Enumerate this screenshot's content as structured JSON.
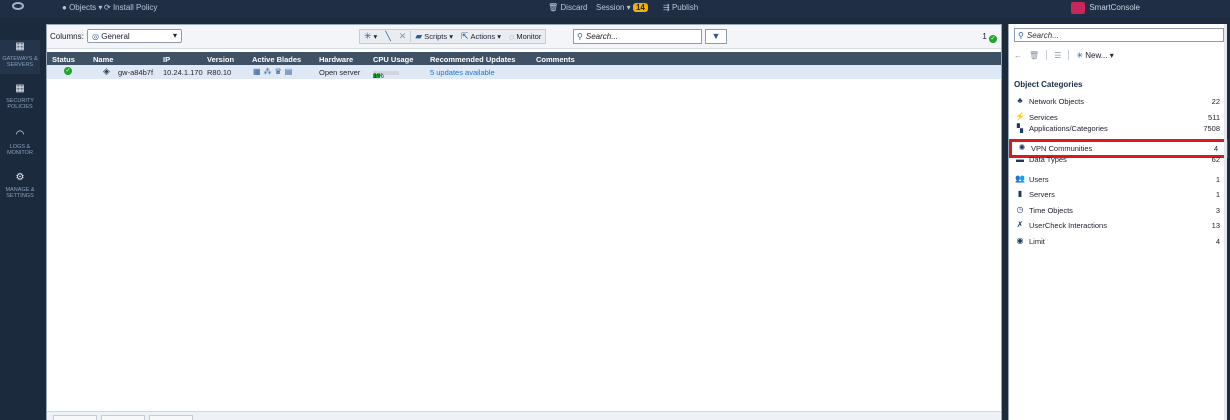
{
  "topbar": {
    "objects_menu": "Objects ▾",
    "install_policy": "Install Policy",
    "discard": "Discard",
    "session": "Session ▾",
    "session_count": "14",
    "publish": "Publish",
    "brand_name": "SmartConsole"
  },
  "leftnav": [
    {
      "label": "GATEWAYS & SERVERS",
      "icon": "gateways-icon"
    },
    {
      "label": "SECURITY POLICIES",
      "icon": "policies-icon"
    },
    {
      "label": "LOGS & MONITOR",
      "icon": "logs-icon"
    },
    {
      "label": "MANAGE & SETTINGS",
      "icon": "settings-icon"
    }
  ],
  "toolbar": {
    "columns_label": "Columns:",
    "columns_value": "General",
    "scripts": "Scripts ▾",
    "actions": "Actions ▾",
    "monitor": "Monitor",
    "search_placeholder": "Search...",
    "count": "1"
  },
  "grid": {
    "headers": [
      "Status",
      "Name",
      "IP",
      "Version",
      "Active Blades",
      "Hardware",
      "CPU Usage",
      "Recommended Updates",
      "Comments"
    ],
    "rows": [
      {
        "status": "ok",
        "name": "gw-a84b7f",
        "ip": "10.24.1.170",
        "version": "R80.10",
        "hardware": "Open server",
        "cpu_usage": "1%",
        "cpu_fraction": 0.25,
        "updates": "5 updates available",
        "comments": ""
      }
    ]
  },
  "right_panel": {
    "search_placeholder": "Search...",
    "new_label": "New... ▾",
    "categories_title": "Object Categories",
    "categories": [
      {
        "label": "Network Objects",
        "count": "22",
        "icon": "network-objects-icon"
      },
      {
        "label": "Services",
        "count": "511",
        "icon": "services-icon"
      },
      {
        "label": "Applications/Categories",
        "count": "7508",
        "icon": "applications-icon"
      },
      {
        "label": "VPN Communities",
        "count": "4",
        "icon": "vpn-communities-icon",
        "highlighted": true
      },
      {
        "label": "Data Types",
        "count": "62",
        "icon": "data-types-icon"
      },
      {
        "label": "Users",
        "count": "1",
        "icon": "users-icon"
      },
      {
        "label": "Servers",
        "count": "1",
        "icon": "servers-icon"
      },
      {
        "label": "Time Objects",
        "count": "3",
        "icon": "time-objects-icon"
      },
      {
        "label": "UserCheck Interactions",
        "count": "13",
        "icon": "usercheck-icon"
      },
      {
        "label": "Limit",
        "count": "4",
        "icon": "limit-icon"
      }
    ]
  },
  "colors": {
    "accent": "#2c5a9a",
    "highlight": "#d71920",
    "status_ok": "#1ea52a",
    "grid_header": "#3f5165",
    "selected_row": "#dfe9f5"
  }
}
